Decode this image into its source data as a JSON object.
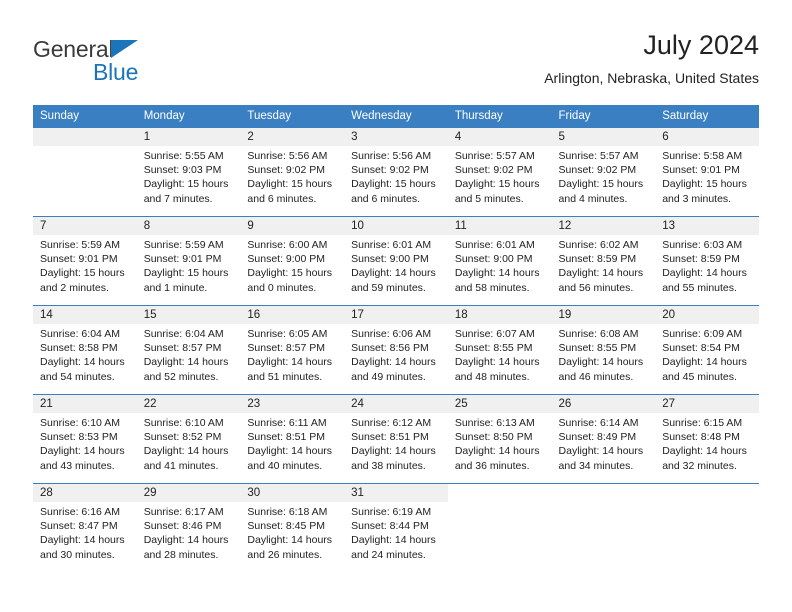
{
  "logo": {
    "primary_text": "General",
    "secondary_text": "Blue",
    "triangle_icon": "triangle-icon",
    "primary_color": "#3b3b3b",
    "accent_color": "#1b75bb"
  },
  "header": {
    "title": "July 2024",
    "subtitle": "Arlington, Nebraska, United States"
  },
  "colors": {
    "header_bar": "#3a7fc1",
    "daynum_band": "#f0f0f0",
    "text": "#222222",
    "cell_background": "#ffffff"
  },
  "calendar": {
    "day_headers": [
      "Sunday",
      "Monday",
      "Tuesday",
      "Wednesday",
      "Thursday",
      "Friday",
      "Saturday"
    ],
    "labels": {
      "sunrise": "Sunrise:",
      "sunset": "Sunset:",
      "daylight": "Daylight:"
    },
    "weeks": [
      [
        {
          "day": "",
          "sunrise": "",
          "sunset": "",
          "daylight_line1": "",
          "daylight_line2": ""
        },
        {
          "day": "1",
          "sunrise": "Sunrise: 5:55 AM",
          "sunset": "Sunset: 9:03 PM",
          "daylight_line1": "Daylight: 15 hours",
          "daylight_line2": "and 7 minutes."
        },
        {
          "day": "2",
          "sunrise": "Sunrise: 5:56 AM",
          "sunset": "Sunset: 9:02 PM",
          "daylight_line1": "Daylight: 15 hours",
          "daylight_line2": "and 6 minutes."
        },
        {
          "day": "3",
          "sunrise": "Sunrise: 5:56 AM",
          "sunset": "Sunset: 9:02 PM",
          "daylight_line1": "Daylight: 15 hours",
          "daylight_line2": "and 6 minutes."
        },
        {
          "day": "4",
          "sunrise": "Sunrise: 5:57 AM",
          "sunset": "Sunset: 9:02 PM",
          "daylight_line1": "Daylight: 15 hours",
          "daylight_line2": "and 5 minutes."
        },
        {
          "day": "5",
          "sunrise": "Sunrise: 5:57 AM",
          "sunset": "Sunset: 9:02 PM",
          "daylight_line1": "Daylight: 15 hours",
          "daylight_line2": "and 4 minutes."
        },
        {
          "day": "6",
          "sunrise": "Sunrise: 5:58 AM",
          "sunset": "Sunset: 9:01 PM",
          "daylight_line1": "Daylight: 15 hours",
          "daylight_line2": "and 3 minutes."
        }
      ],
      [
        {
          "day": "7",
          "sunrise": "Sunrise: 5:59 AM",
          "sunset": "Sunset: 9:01 PM",
          "daylight_line1": "Daylight: 15 hours",
          "daylight_line2": "and 2 minutes."
        },
        {
          "day": "8",
          "sunrise": "Sunrise: 5:59 AM",
          "sunset": "Sunset: 9:01 PM",
          "daylight_line1": "Daylight: 15 hours",
          "daylight_line2": "and 1 minute."
        },
        {
          "day": "9",
          "sunrise": "Sunrise: 6:00 AM",
          "sunset": "Sunset: 9:00 PM",
          "daylight_line1": "Daylight: 15 hours",
          "daylight_line2": "and 0 minutes."
        },
        {
          "day": "10",
          "sunrise": "Sunrise: 6:01 AM",
          "sunset": "Sunset: 9:00 PM",
          "daylight_line1": "Daylight: 14 hours",
          "daylight_line2": "and 59 minutes."
        },
        {
          "day": "11",
          "sunrise": "Sunrise: 6:01 AM",
          "sunset": "Sunset: 9:00 PM",
          "daylight_line1": "Daylight: 14 hours",
          "daylight_line2": "and 58 minutes."
        },
        {
          "day": "12",
          "sunrise": "Sunrise: 6:02 AM",
          "sunset": "Sunset: 8:59 PM",
          "daylight_line1": "Daylight: 14 hours",
          "daylight_line2": "and 56 minutes."
        },
        {
          "day": "13",
          "sunrise": "Sunrise: 6:03 AM",
          "sunset": "Sunset: 8:59 PM",
          "daylight_line1": "Daylight: 14 hours",
          "daylight_line2": "and 55 minutes."
        }
      ],
      [
        {
          "day": "14",
          "sunrise": "Sunrise: 6:04 AM",
          "sunset": "Sunset: 8:58 PM",
          "daylight_line1": "Daylight: 14 hours",
          "daylight_line2": "and 54 minutes."
        },
        {
          "day": "15",
          "sunrise": "Sunrise: 6:04 AM",
          "sunset": "Sunset: 8:57 PM",
          "daylight_line1": "Daylight: 14 hours",
          "daylight_line2": "and 52 minutes."
        },
        {
          "day": "16",
          "sunrise": "Sunrise: 6:05 AM",
          "sunset": "Sunset: 8:57 PM",
          "daylight_line1": "Daylight: 14 hours",
          "daylight_line2": "and 51 minutes."
        },
        {
          "day": "17",
          "sunrise": "Sunrise: 6:06 AM",
          "sunset": "Sunset: 8:56 PM",
          "daylight_line1": "Daylight: 14 hours",
          "daylight_line2": "and 49 minutes."
        },
        {
          "day": "18",
          "sunrise": "Sunrise: 6:07 AM",
          "sunset": "Sunset: 8:55 PM",
          "daylight_line1": "Daylight: 14 hours",
          "daylight_line2": "and 48 minutes."
        },
        {
          "day": "19",
          "sunrise": "Sunrise: 6:08 AM",
          "sunset": "Sunset: 8:55 PM",
          "daylight_line1": "Daylight: 14 hours",
          "daylight_line2": "and 46 minutes."
        },
        {
          "day": "20",
          "sunrise": "Sunrise: 6:09 AM",
          "sunset": "Sunset: 8:54 PM",
          "daylight_line1": "Daylight: 14 hours",
          "daylight_line2": "and 45 minutes."
        }
      ],
      [
        {
          "day": "21",
          "sunrise": "Sunrise: 6:10 AM",
          "sunset": "Sunset: 8:53 PM",
          "daylight_line1": "Daylight: 14 hours",
          "daylight_line2": "and 43 minutes."
        },
        {
          "day": "22",
          "sunrise": "Sunrise: 6:10 AM",
          "sunset": "Sunset: 8:52 PM",
          "daylight_line1": "Daylight: 14 hours",
          "daylight_line2": "and 41 minutes."
        },
        {
          "day": "23",
          "sunrise": "Sunrise: 6:11 AM",
          "sunset": "Sunset: 8:51 PM",
          "daylight_line1": "Daylight: 14 hours",
          "daylight_line2": "and 40 minutes."
        },
        {
          "day": "24",
          "sunrise": "Sunrise: 6:12 AM",
          "sunset": "Sunset: 8:51 PM",
          "daylight_line1": "Daylight: 14 hours",
          "daylight_line2": "and 38 minutes."
        },
        {
          "day": "25",
          "sunrise": "Sunrise: 6:13 AM",
          "sunset": "Sunset: 8:50 PM",
          "daylight_line1": "Daylight: 14 hours",
          "daylight_line2": "and 36 minutes."
        },
        {
          "day": "26",
          "sunrise": "Sunrise: 6:14 AM",
          "sunset": "Sunset: 8:49 PM",
          "daylight_line1": "Daylight: 14 hours",
          "daylight_line2": "and 34 minutes."
        },
        {
          "day": "27",
          "sunrise": "Sunrise: 6:15 AM",
          "sunset": "Sunset: 8:48 PM",
          "daylight_line1": "Daylight: 14 hours",
          "daylight_line2": "and 32 minutes."
        }
      ],
      [
        {
          "day": "28",
          "sunrise": "Sunrise: 6:16 AM",
          "sunset": "Sunset: 8:47 PM",
          "daylight_line1": "Daylight: 14 hours",
          "daylight_line2": "and 30 minutes."
        },
        {
          "day": "29",
          "sunrise": "Sunrise: 6:17 AM",
          "sunset": "Sunset: 8:46 PM",
          "daylight_line1": "Daylight: 14 hours",
          "daylight_line2": "and 28 minutes."
        },
        {
          "day": "30",
          "sunrise": "Sunrise: 6:18 AM",
          "sunset": "Sunset: 8:45 PM",
          "daylight_line1": "Daylight: 14 hours",
          "daylight_line2": "and 26 minutes."
        },
        {
          "day": "31",
          "sunrise": "Sunrise: 6:19 AM",
          "sunset": "Sunset: 8:44 PM",
          "daylight_line1": "Daylight: 14 hours",
          "daylight_line2": "and 24 minutes."
        },
        {
          "day": "",
          "sunrise": "",
          "sunset": "",
          "daylight_line1": "",
          "daylight_line2": ""
        },
        {
          "day": "",
          "sunrise": "",
          "sunset": "",
          "daylight_line1": "",
          "daylight_line2": ""
        },
        {
          "day": "",
          "sunrise": "",
          "sunset": "",
          "daylight_line1": "",
          "daylight_line2": ""
        }
      ]
    ]
  }
}
